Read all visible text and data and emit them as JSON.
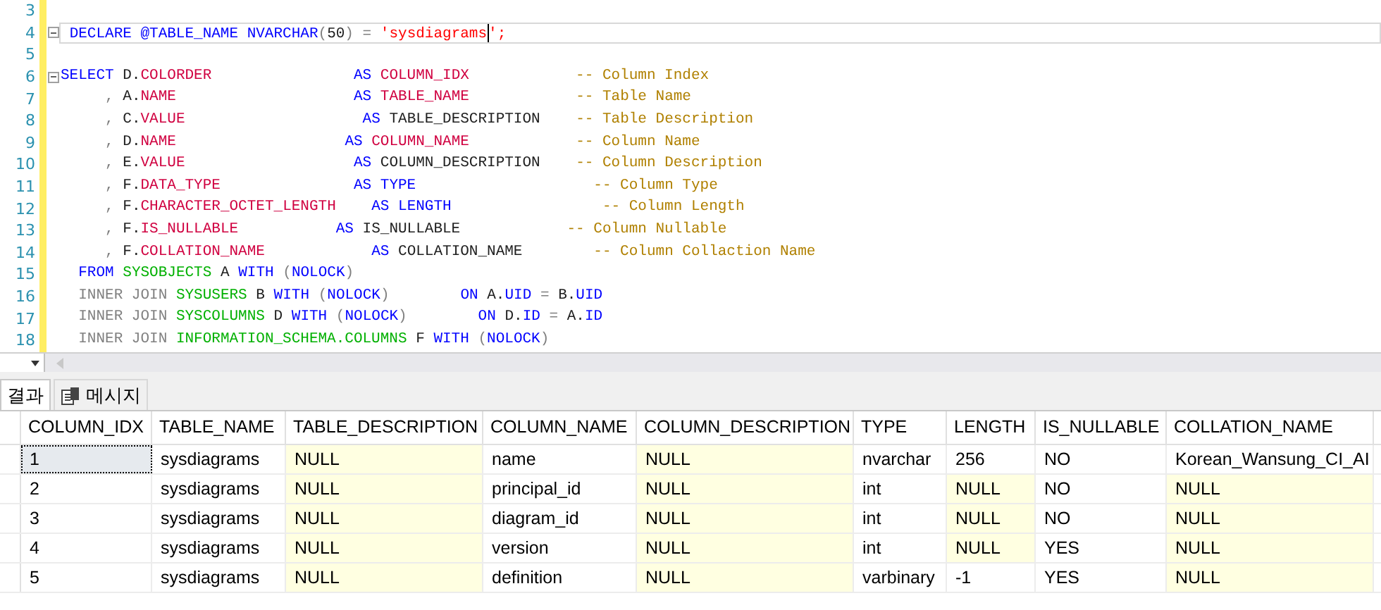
{
  "editor": {
    "lines": [
      {
        "number": "3",
        "fold": false,
        "current": false
      },
      {
        "number": "4",
        "fold": true,
        "current": true,
        "tokens": [
          {
            "kind": "keyword",
            "text": " DECLARE @TABLE_NAME NVARCHAR"
          },
          {
            "kind": "punct",
            "text": "("
          },
          {
            "kind": "text",
            "text": "50"
          },
          {
            "kind": "punct",
            "text": ")"
          },
          {
            "kind": "punct",
            "text": " ="
          },
          {
            "kind": "string",
            "text": " 'sysdiagrams"
          },
          {
            "kind": "string",
            "text": "';"
          }
        ]
      },
      {
        "number": "5",
        "fold": false,
        "current": false
      },
      {
        "number": "6",
        "fold": true,
        "current": false,
        "tokens": [
          {
            "kind": "keyword",
            "text": "SELECT"
          },
          {
            "kind": "text",
            "text": " D."
          },
          {
            "kind": "column",
            "text": "COLORDER"
          },
          {
            "kind": "keyword",
            "text": "                AS"
          },
          {
            "kind": "column",
            "text": " COLUMN_IDX"
          },
          {
            "kind": "comment",
            "text": "            -- Column Index"
          }
        ]
      },
      {
        "number": "7",
        "fold": false,
        "current": false,
        "tokens": [
          {
            "kind": "punct",
            "text": "     ,"
          },
          {
            "kind": "text",
            "text": " A."
          },
          {
            "kind": "column",
            "text": "NAME"
          },
          {
            "kind": "keyword",
            "text": "                    AS"
          },
          {
            "kind": "column",
            "text": " TABLE_NAME"
          },
          {
            "kind": "comment",
            "text": "            -- Table Name"
          }
        ]
      },
      {
        "number": "8",
        "fold": false,
        "current": false,
        "tokens": [
          {
            "kind": "punct",
            "text": "     ,"
          },
          {
            "kind": "text",
            "text": " C."
          },
          {
            "kind": "column",
            "text": "VALUE"
          },
          {
            "kind": "keyword",
            "text": "                    AS"
          },
          {
            "kind": "text",
            "text": " TABLE_DESCRIPTION"
          },
          {
            "kind": "comment",
            "text": "    -- Table Description"
          }
        ]
      },
      {
        "number": "9",
        "fold": false,
        "current": false,
        "tokens": [
          {
            "kind": "punct",
            "text": "     ,"
          },
          {
            "kind": "text",
            "text": " D."
          },
          {
            "kind": "column",
            "text": "NAME"
          },
          {
            "kind": "keyword",
            "text": "                   AS"
          },
          {
            "kind": "column",
            "text": " COLUMN_NAME"
          },
          {
            "kind": "comment",
            "text": "            -- Column Name"
          }
        ]
      },
      {
        "number": "10",
        "fold": false,
        "current": false,
        "tokens": [
          {
            "kind": "punct",
            "text": "     ,"
          },
          {
            "kind": "text",
            "text": " E."
          },
          {
            "kind": "column",
            "text": "VALUE"
          },
          {
            "kind": "keyword",
            "text": "                   AS"
          },
          {
            "kind": "text",
            "text": " COLUMN_DESCRIPTION"
          },
          {
            "kind": "comment",
            "text": "    -- Column Description"
          }
        ]
      },
      {
        "number": "11",
        "fold": false,
        "current": false,
        "tokens": [
          {
            "kind": "punct",
            "text": "     ,"
          },
          {
            "kind": "text",
            "text": " F."
          },
          {
            "kind": "column",
            "text": "DATA_TYPE"
          },
          {
            "kind": "keyword",
            "text": "               AS"
          },
          {
            "kind": "keyword",
            "text": " TYPE"
          },
          {
            "kind": "comment",
            "text": "                    -- Column Type"
          }
        ]
      },
      {
        "number": "12",
        "fold": false,
        "current": false,
        "tokens": [
          {
            "kind": "punct",
            "text": "     ,"
          },
          {
            "kind": "text",
            "text": " F."
          },
          {
            "kind": "column",
            "text": "CHARACTER_OCTET_LENGTH"
          },
          {
            "kind": "keyword",
            "text": "    AS"
          },
          {
            "kind": "keyword",
            "text": " LENGTH"
          },
          {
            "kind": "comment",
            "text": "                 -- Column Length"
          }
        ]
      },
      {
        "number": "13",
        "fold": false,
        "current": false,
        "tokens": [
          {
            "kind": "punct",
            "text": "     ,"
          },
          {
            "kind": "text",
            "text": " F."
          },
          {
            "kind": "column",
            "text": "IS_NULLABLE"
          },
          {
            "kind": "keyword",
            "text": "           AS"
          },
          {
            "kind": "text",
            "text": " IS_NULLABLE"
          },
          {
            "kind": "comment",
            "text": "            -- Column Nullable"
          }
        ]
      },
      {
        "number": "14",
        "fold": false,
        "current": false,
        "tokens": [
          {
            "kind": "punct",
            "text": "     ,"
          },
          {
            "kind": "text",
            "text": " F."
          },
          {
            "kind": "column",
            "text": "COLLATION_NAME"
          },
          {
            "kind": "keyword",
            "text": "            AS"
          },
          {
            "kind": "text",
            "text": " COLLATION_NAME"
          },
          {
            "kind": "comment",
            "text": "        -- Column Collaction Name"
          }
        ]
      },
      {
        "number": "15",
        "fold": false,
        "current": false,
        "tokens": [
          {
            "kind": "keyword",
            "text": "  FROM"
          },
          {
            "kind": "system",
            "text": " SYSOBJECTS"
          },
          {
            "kind": "text",
            "text": " A"
          },
          {
            "kind": "keyword",
            "text": " WITH"
          },
          {
            "kind": "punct",
            "text": " ("
          },
          {
            "kind": "keyword",
            "text": "NOLOCK"
          },
          {
            "kind": "punct",
            "text": ")"
          }
        ]
      },
      {
        "number": "16",
        "fold": false,
        "current": false,
        "tokens": [
          {
            "kind": "punct",
            "text": "  INNER JOIN"
          },
          {
            "kind": "system",
            "text": " SYSUSERS"
          },
          {
            "kind": "text",
            "text": " B"
          },
          {
            "kind": "keyword",
            "text": " WITH"
          },
          {
            "kind": "punct",
            "text": " ("
          },
          {
            "kind": "keyword",
            "text": "NOLOCK"
          },
          {
            "kind": "punct",
            "text": ")"
          },
          {
            "kind": "keyword",
            "text": "        ON"
          },
          {
            "kind": "text",
            "text": " A."
          },
          {
            "kind": "keyword",
            "text": "UID"
          },
          {
            "kind": "punct",
            "text": " ="
          },
          {
            "kind": "text",
            "text": " B."
          },
          {
            "kind": "keyword",
            "text": "UID"
          }
        ]
      },
      {
        "number": "17",
        "fold": false,
        "current": false,
        "tokens": [
          {
            "kind": "punct",
            "text": "  INNER JOIN"
          },
          {
            "kind": "system",
            "text": " SYSCOLUMNS"
          },
          {
            "kind": "text",
            "text": " D"
          },
          {
            "kind": "keyword",
            "text": " WITH"
          },
          {
            "kind": "punct",
            "text": " ("
          },
          {
            "kind": "keyword",
            "text": "NOLOCK"
          },
          {
            "kind": "punct",
            "text": ")"
          },
          {
            "kind": "keyword",
            "text": "        ON"
          },
          {
            "kind": "text",
            "text": " D."
          },
          {
            "kind": "keyword",
            "text": "ID"
          },
          {
            "kind": "punct",
            "text": " ="
          },
          {
            "kind": "text",
            "text": " A."
          },
          {
            "kind": "keyword",
            "text": "ID"
          }
        ]
      },
      {
        "number": "18",
        "fold": false,
        "current": false,
        "tokens": [
          {
            "kind": "punct",
            "text": "  INNER JOIN"
          },
          {
            "kind": "system",
            "text": " INFORMATION_SCHEMA.COLUMNS"
          },
          {
            "kind": "text",
            "text": " F"
          },
          {
            "kind": "keyword",
            "text": " WITH"
          },
          {
            "kind": "punct",
            "text": " ("
          },
          {
            "kind": "keyword",
            "text": "NOLOCK"
          },
          {
            "kind": "punct",
            "text": ")"
          }
        ]
      }
    ]
  },
  "tabs": [
    {
      "label": "결과",
      "icon": false,
      "selected": true
    },
    {
      "label": "메시지",
      "icon": true,
      "selected": false
    }
  ],
  "grid": {
    "columns": [
      "COLUMN_IDX",
      "TABLE_NAME",
      "TABLE_DESCRIPTION",
      "COLUMN_NAME",
      "COLUMN_DESCRIPTION",
      "TYPE",
      "LENGTH",
      "IS_NULLABLE",
      "COLLATION_NAME"
    ],
    "rows": [
      [
        {
          "t": "1",
          "null": false,
          "selected": true
        },
        {
          "t": "sysdiagrams",
          "null": false,
          "selected": false
        },
        {
          "t": "NULL",
          "null": true,
          "selected": false
        },
        {
          "t": "name",
          "null": false,
          "selected": false
        },
        {
          "t": "NULL",
          "null": true,
          "selected": false
        },
        {
          "t": "nvarchar",
          "null": false,
          "selected": false
        },
        {
          "t": "256",
          "null": false,
          "selected": false
        },
        {
          "t": "NO",
          "null": false,
          "selected": false
        },
        {
          "t": "Korean_Wansung_CI_AI",
          "null": false,
          "selected": false
        }
      ],
      [
        {
          "t": "2",
          "null": false,
          "selected": false
        },
        {
          "t": "sysdiagrams",
          "null": false,
          "selected": false
        },
        {
          "t": "NULL",
          "null": true,
          "selected": false
        },
        {
          "t": "principal_id",
          "null": false,
          "selected": false
        },
        {
          "t": "NULL",
          "null": true,
          "selected": false
        },
        {
          "t": "int",
          "null": false,
          "selected": false
        },
        {
          "t": "NULL",
          "null": true,
          "selected": false
        },
        {
          "t": "NO",
          "null": false,
          "selected": false
        },
        {
          "t": "NULL",
          "null": true,
          "selected": false
        }
      ],
      [
        {
          "t": "3",
          "null": false,
          "selected": false
        },
        {
          "t": "sysdiagrams",
          "null": false,
          "selected": false
        },
        {
          "t": "NULL",
          "null": true,
          "selected": false
        },
        {
          "t": "diagram_id",
          "null": false,
          "selected": false
        },
        {
          "t": "NULL",
          "null": true,
          "selected": false
        },
        {
          "t": "int",
          "null": false,
          "selected": false
        },
        {
          "t": "NULL",
          "null": true,
          "selected": false
        },
        {
          "t": "NO",
          "null": false,
          "selected": false
        },
        {
          "t": "NULL",
          "null": true,
          "selected": false
        }
      ],
      [
        {
          "t": "4",
          "null": false,
          "selected": false
        },
        {
          "t": "sysdiagrams",
          "null": false,
          "selected": false
        },
        {
          "t": "NULL",
          "null": true,
          "selected": false
        },
        {
          "t": "version",
          "null": false,
          "selected": false
        },
        {
          "t": "NULL",
          "null": true,
          "selected": false
        },
        {
          "t": "int",
          "null": false,
          "selected": false
        },
        {
          "t": "NULL",
          "null": true,
          "selected": false
        },
        {
          "t": "YES",
          "null": false,
          "selected": false
        },
        {
          "t": "NULL",
          "null": true,
          "selected": false
        }
      ],
      [
        {
          "t": "5",
          "null": false,
          "selected": false
        },
        {
          "t": "sysdiagrams",
          "null": false,
          "selected": false
        },
        {
          "t": "NULL",
          "null": true,
          "selected": false
        },
        {
          "t": "definition",
          "null": false,
          "selected": false
        },
        {
          "t": "NULL",
          "null": true,
          "selected": false
        },
        {
          "t": "varbinary",
          "null": false,
          "selected": false
        },
        {
          "t": "-1",
          "null": false,
          "selected": false
        },
        {
          "t": "YES",
          "null": false,
          "selected": false
        },
        {
          "t": "NULL",
          "null": true,
          "selected": false
        }
      ]
    ]
  }
}
